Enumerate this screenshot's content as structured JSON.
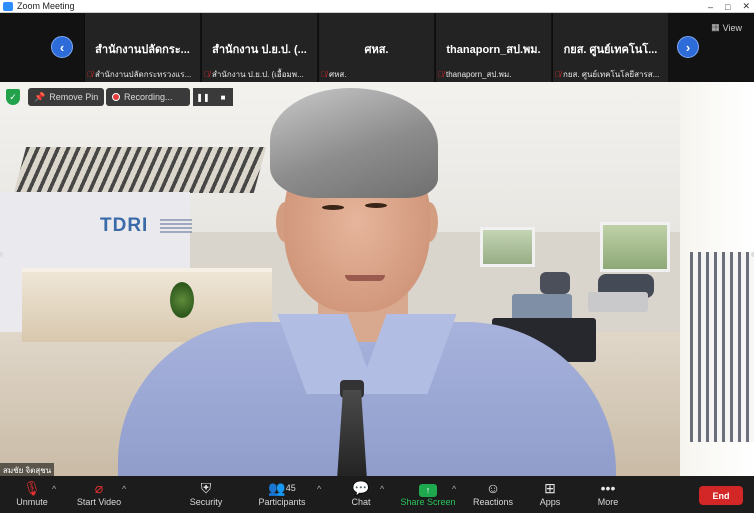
{
  "window": {
    "title": "Zoom Meeting",
    "controls": [
      "–",
      "□",
      "✕"
    ]
  },
  "gallery": {
    "view_label": "View",
    "tiles": [
      {
        "big": "สำนักงานปลัดกระ...",
        "small": "สำนักงานปลัดกระทรวงแร..."
      },
      {
        "big": "สำนักงาน ป.ย.ป. (...",
        "small": "สำนักงาน ป.ย.ป. (เอื้อมพ..."
      },
      {
        "big": "ศหส.",
        "small": "ศหส."
      },
      {
        "big": "thanaporn_สป.พม.",
        "small": "thanaporn_สป.พม."
      },
      {
        "big": "กยส. ศูนย์เทคโนโ...",
        "small": "กยส. ศูนย์เทคโนโลยีสารส..."
      }
    ],
    "prev_arrow": "‹",
    "next_arrow": "›"
  },
  "video": {
    "remove_pin": "Remove Pin",
    "recording": "Recording...",
    "pause": "❚❚",
    "stop": "■",
    "speaker_name": "สมชัย จิตสุชน",
    "background_logo": "TDRI"
  },
  "toolbar": {
    "unmute": "Unmute",
    "start_video": "Start Video",
    "security": "Security",
    "participants": "Participants",
    "participants_count": "45",
    "chat": "Chat",
    "share_screen": "Share Screen",
    "reactions": "Reactions",
    "apps": "Apps",
    "more": "More",
    "end": "End"
  }
}
